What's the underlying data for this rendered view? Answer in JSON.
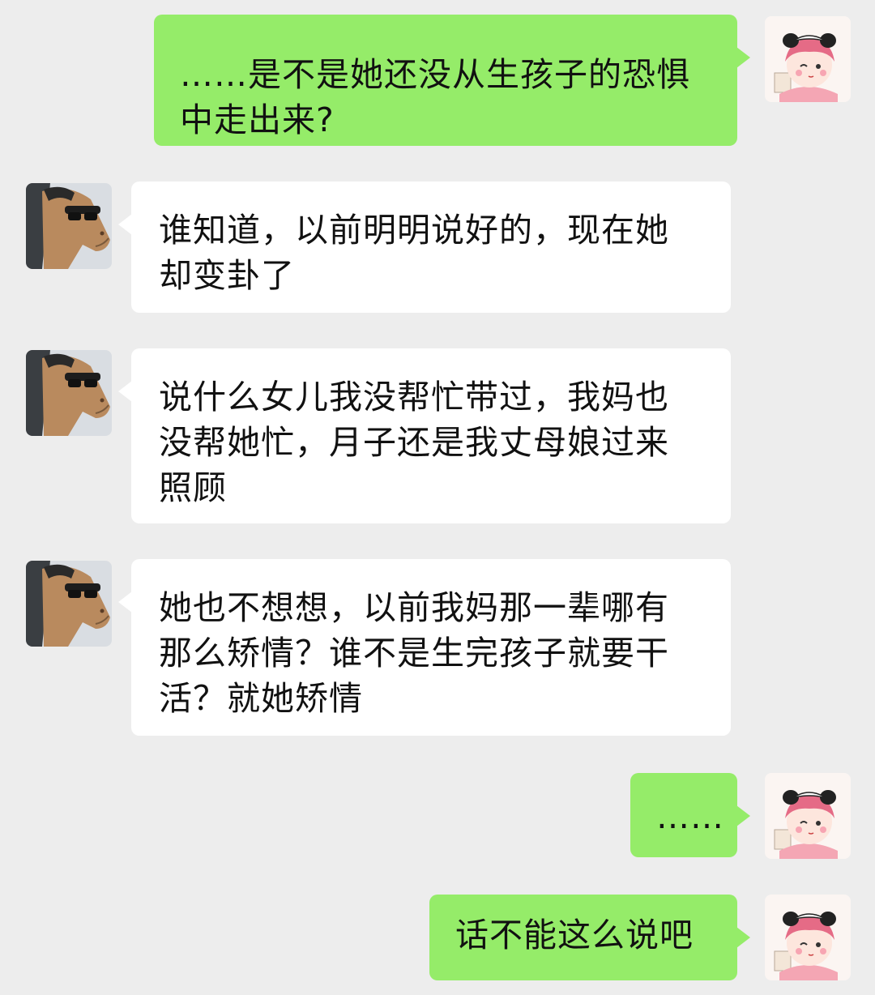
{
  "messages": [
    {
      "side": "out",
      "avatar": "panda-girl-avatar",
      "text": "……是不是她还没从生孩子的恐惧\n中走出来?"
    },
    {
      "side": "in",
      "avatar": "horse-avatar",
      "text": "谁知道，以前明明说好的，现在她\n却变卦了"
    },
    {
      "side": "in",
      "avatar": "horse-avatar",
      "text": "说什么女儿我没帮忙带过，我妈也\n没帮她忙，月子还是我丈母娘过来\n照顾"
    },
    {
      "side": "in",
      "avatar": "horse-avatar",
      "text": "她也不想想，以前我妈那一辈哪有\n那么矫情？谁不是生完孩子就要干\n活？就她矫情"
    },
    {
      "side": "out",
      "avatar": "panda-girl-avatar",
      "text": "……"
    },
    {
      "side": "out",
      "avatar": "panda-girl-avatar",
      "text": "话不能这么说吧"
    }
  ],
  "colors": {
    "background": "#ededed",
    "outgoing_bubble": "#95ec69",
    "incoming_bubble": "#ffffff"
  }
}
